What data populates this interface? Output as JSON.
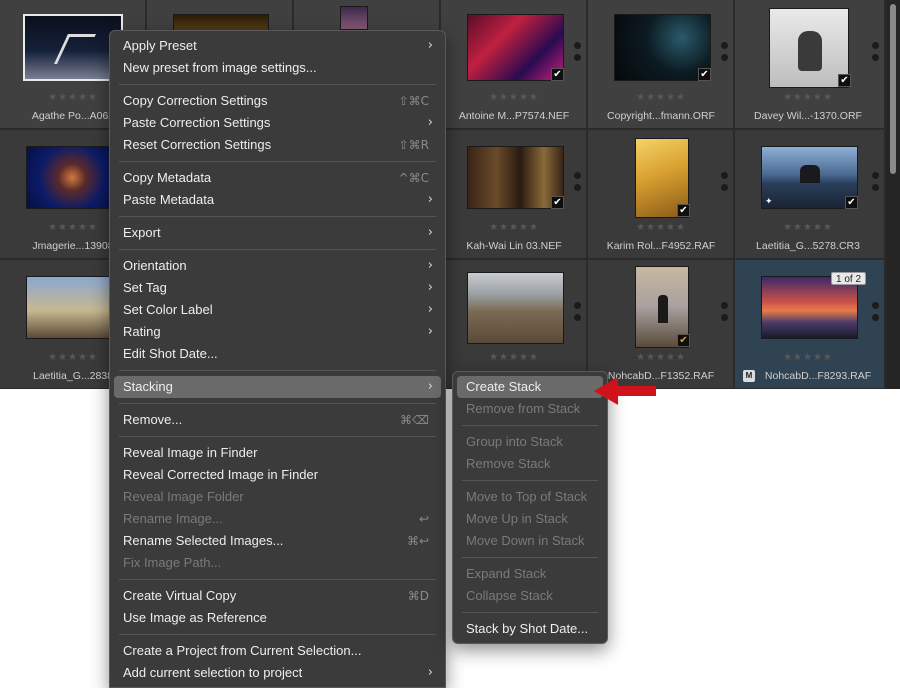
{
  "accent": "#6a6a6a",
  "arrow_color": "#d0121b",
  "grid": {
    "cells": [
      {
        "name": "Agathe Po...A062",
        "stars": "★★★★★"
      },
      {
        "name": "",
        "stars": ""
      },
      {
        "name": "",
        "stars": ""
      },
      {
        "name": "Antoine M...P7574.NEF",
        "stars": "★★★★★"
      },
      {
        "name": "Copyright...fmann.ORF",
        "stars": "★★★★★"
      },
      {
        "name": "Davey Wil...-1370.ORF",
        "stars": "★★★★★"
      },
      {
        "name": "Jmagerie...13908",
        "stars": "★★★★★"
      },
      {
        "name": "Kah-Wai Lin 03.NEF",
        "stars": "★★★★★"
      },
      {
        "name": "Karim Rol...F4952.RAF",
        "stars": "★★★★★"
      },
      {
        "name": "Laetitia_G...5278.CR3",
        "stars": "★★★★★"
      },
      {
        "name": "Laetitia_G...2838",
        "stars": "★★★★★"
      },
      {
        "name": "",
        "stars": "★★★★★"
      },
      {
        "name": "NohcabD...F1352.RAF",
        "stars": "★★★★★"
      },
      {
        "name": "NohcabD...F8293.RAF",
        "stars": "★★★★★"
      }
    ],
    "stack_badge": "1 of 2",
    "m_badge": "M",
    "check_glyph": "✔"
  },
  "menu": {
    "items": [
      {
        "label": "Apply Preset",
        "shortcut": "",
        "submenu": true,
        "disabled": false
      },
      {
        "label": "New preset from image settings...",
        "shortcut": "",
        "submenu": false,
        "disabled": false
      },
      {
        "label": "Copy Correction Settings",
        "shortcut": "⇧⌘C",
        "submenu": false,
        "disabled": false
      },
      {
        "label": "Paste Correction Settings",
        "shortcut": "",
        "submenu": true,
        "disabled": false
      },
      {
        "label": "Reset Correction Settings",
        "shortcut": "⇧⌘R",
        "submenu": false,
        "disabled": false
      },
      {
        "label": "Copy Metadata",
        "shortcut": "^⌘C",
        "submenu": false,
        "disabled": false
      },
      {
        "label": "Paste Metadata",
        "shortcut": "",
        "submenu": true,
        "disabled": false
      },
      {
        "label": "Export",
        "shortcut": "",
        "submenu": true,
        "disabled": false
      },
      {
        "label": "Orientation",
        "shortcut": "",
        "submenu": true,
        "disabled": false
      },
      {
        "label": "Set Tag",
        "shortcut": "",
        "submenu": true,
        "disabled": false
      },
      {
        "label": "Set Color Label",
        "shortcut": "",
        "submenu": true,
        "disabled": false
      },
      {
        "label": "Rating",
        "shortcut": "",
        "submenu": true,
        "disabled": false
      },
      {
        "label": "Edit Shot Date...",
        "shortcut": "",
        "submenu": false,
        "disabled": false
      },
      {
        "label": "Stacking",
        "shortcut": "",
        "submenu": true,
        "disabled": false
      },
      {
        "label": "Remove...",
        "shortcut": "⌘⌫",
        "submenu": false,
        "disabled": false
      },
      {
        "label": "Reveal Image in Finder",
        "shortcut": "",
        "submenu": false,
        "disabled": false
      },
      {
        "label": "Reveal Corrected Image in Finder",
        "shortcut": "",
        "submenu": false,
        "disabled": false
      },
      {
        "label": "Reveal Image Folder",
        "shortcut": "",
        "submenu": false,
        "disabled": true
      },
      {
        "label": "Rename Image...",
        "shortcut": "↩",
        "submenu": false,
        "disabled": true
      },
      {
        "label": "Rename Selected Images...",
        "shortcut": "⌘↩",
        "submenu": false,
        "disabled": false
      },
      {
        "label": "Fix Image Path...",
        "shortcut": "",
        "submenu": false,
        "disabled": true
      },
      {
        "label": "Create Virtual Copy",
        "shortcut": "⌘D",
        "submenu": false,
        "disabled": false
      },
      {
        "label": "Use Image as Reference",
        "shortcut": "",
        "submenu": false,
        "disabled": false
      },
      {
        "label": "Create a Project from Current Selection...",
        "shortcut": "",
        "submenu": false,
        "disabled": false
      },
      {
        "label": "Add current selection to project",
        "shortcut": "",
        "submenu": true,
        "disabled": false
      }
    ],
    "chevron": "›"
  },
  "submenu": {
    "items": [
      {
        "label": "Create Stack",
        "disabled": false
      },
      {
        "label": "Remove from Stack",
        "disabled": true
      },
      {
        "label": "Group into Stack",
        "disabled": true
      },
      {
        "label": "Remove Stack",
        "disabled": true
      },
      {
        "label": "Move to Top of Stack",
        "disabled": true
      },
      {
        "label": "Move Up in Stack",
        "disabled": true
      },
      {
        "label": "Move Down in Stack",
        "disabled": true
      },
      {
        "label": "Expand Stack",
        "disabled": true
      },
      {
        "label": "Collapse Stack",
        "disabled": true
      },
      {
        "label": "Stack by Shot Date...",
        "disabled": false
      }
    ]
  }
}
